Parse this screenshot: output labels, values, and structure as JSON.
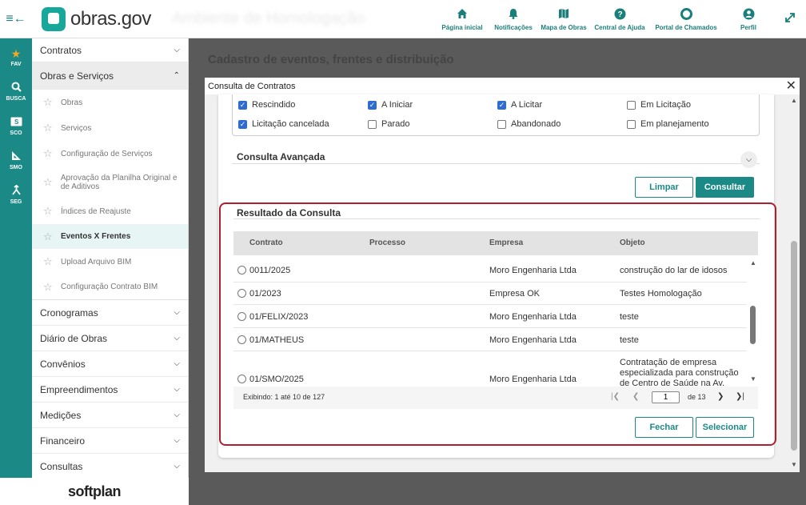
{
  "header": {
    "menu_icon": "menu-collapse-icon",
    "logo_text": "obras.gov",
    "environment": "Ambiente de Homologação",
    "nav": [
      {
        "label": "Página inicial",
        "icon": "home-icon"
      },
      {
        "label": "Notificações",
        "icon": "bell-icon"
      },
      {
        "label": "Mapa de Obras",
        "icon": "map-icon"
      },
      {
        "label": "Central de Ajuda",
        "icon": "help-icon"
      },
      {
        "label": "Portal de Chamados",
        "icon": "lifebuoy-icon"
      },
      {
        "label": "Perfil",
        "icon": "user-icon"
      }
    ],
    "accent": "#1b8a86"
  },
  "rail": [
    {
      "label": "FAV",
      "icon": "star-icon",
      "glyph": "★"
    },
    {
      "label": "BUSCA",
      "icon": "search-icon",
      "glyph": "🔍"
    },
    {
      "label": "SCO",
      "icon": "sco-icon",
      "glyph": "S"
    },
    {
      "label": "SMO",
      "icon": "ruler-icon",
      "glyph": "◣"
    },
    {
      "label": "SEG",
      "icon": "merge-icon",
      "glyph": "⅄"
    }
  ],
  "sidebar": {
    "groups_top": [
      {
        "label": "Contratos"
      }
    ],
    "open_group": {
      "label": "Obras e Serviços"
    },
    "subitems": [
      {
        "label": "Obras"
      },
      {
        "label": "Serviços"
      },
      {
        "label": "Configuração de Serviços"
      },
      {
        "label": "Aprovação da Planilha Original e de Aditivos"
      },
      {
        "label": "Índices de Reajuste"
      },
      {
        "label": "Eventos X Frentes"
      },
      {
        "label": "Upload Arquivo BIM"
      },
      {
        "label": "Configuração Contrato BIM"
      }
    ],
    "groups_bottom": [
      {
        "label": "Cronogramas"
      },
      {
        "label": "Diário de Obras"
      },
      {
        "label": "Convênios"
      },
      {
        "label": "Empreendimentos"
      },
      {
        "label": "Medições"
      },
      {
        "label": "Financeiro"
      },
      {
        "label": "Consultas"
      }
    ],
    "footer_brand": "softplan"
  },
  "page": {
    "title": "Cadastro de eventos, frentes e distribuição"
  },
  "modal": {
    "title": "Consulta de Contratos",
    "status_options": [
      {
        "label": "Rescindido",
        "checked": true
      },
      {
        "label": "A Iniciar",
        "checked": true
      },
      {
        "label": "A Licitar",
        "checked": true
      },
      {
        "label": "Em Licitação",
        "checked": false
      },
      {
        "label": "Licitação cancelada",
        "checked": true
      },
      {
        "label": "Parado",
        "checked": false
      },
      {
        "label": "Abandonado",
        "checked": false
      },
      {
        "label": "Em planejamento",
        "checked": false
      }
    ],
    "advanced_label": "Consulta Avançada",
    "clear_label": "Limpar",
    "search_label": "Consultar",
    "results_title": "Resultado da Consulta",
    "columns": [
      "Contrato",
      "Processo",
      "Empresa",
      "Objeto"
    ],
    "rows": [
      {
        "contrato": "0011/2025",
        "processo": "",
        "empresa": "Moro Engenharia Ltda",
        "objeto": "construção do lar de idosos"
      },
      {
        "contrato": "01/2023",
        "processo": "",
        "empresa": "Empresa OK",
        "objeto": "Testes Homologação"
      },
      {
        "contrato": "01/FELIX/2023",
        "processo": "",
        "empresa": "Moro Engenharia Ltda",
        "objeto": "teste"
      },
      {
        "contrato": "01/MATHEUS",
        "processo": "",
        "empresa": "Moro Engenharia Ltda",
        "objeto": "teste"
      },
      {
        "contrato": "01/SMO/2025",
        "processo": "",
        "empresa": "Moro Engenharia Ltda",
        "objeto": "Contratação de empresa especializada para construção de Centro de Saúde na Av."
      }
    ],
    "pager": {
      "info": "Exibindo: 1 até 10 de 127",
      "page": "1",
      "of_label": "de 13"
    },
    "close_label": "Fechar",
    "select_label": "Selecionar"
  }
}
